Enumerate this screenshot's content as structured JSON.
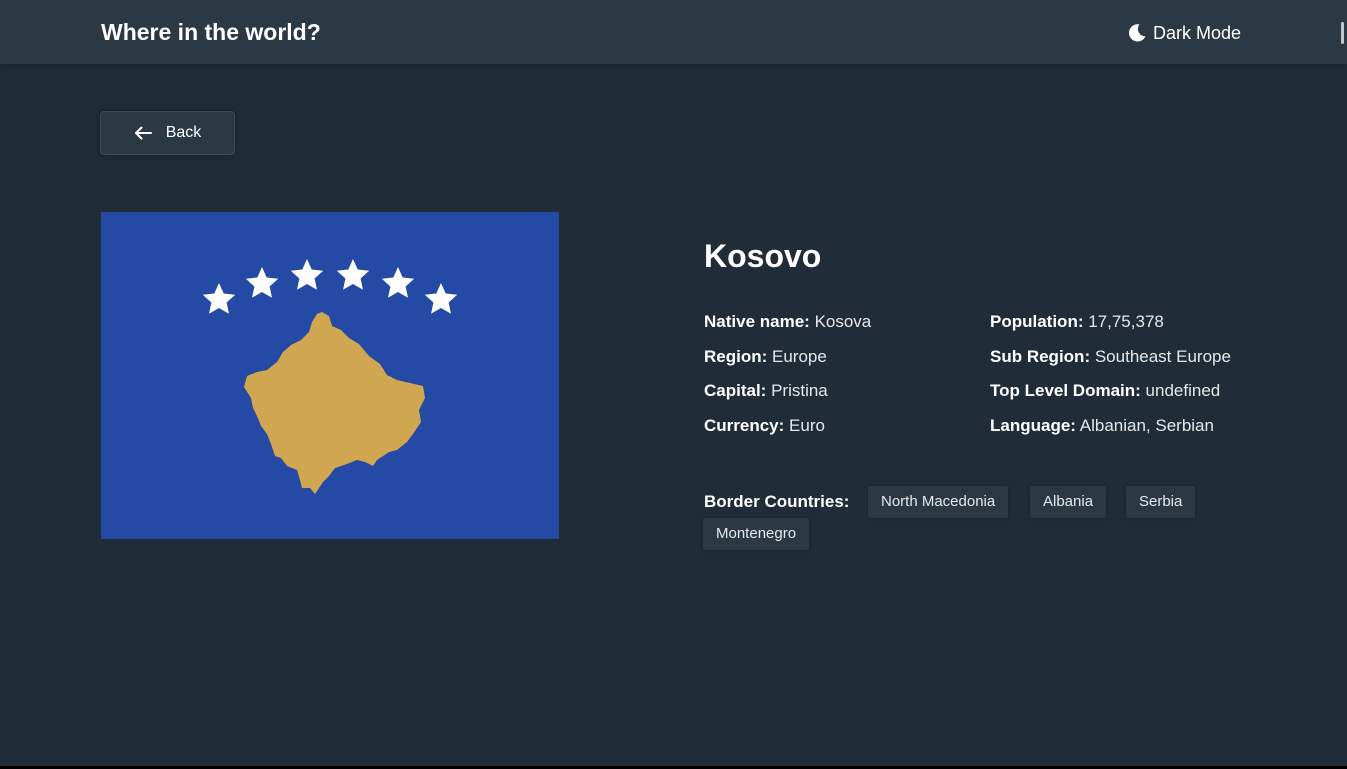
{
  "header": {
    "title": "Where in the world?",
    "dark_mode_label": "Dark Mode",
    "moon_icon": "moon-icon"
  },
  "back_button": {
    "label": "Back",
    "icon": "arrow-left-icon"
  },
  "country": {
    "name": "Kosovo",
    "flag": {
      "icon": "kosovo-flag",
      "field_color": "#244aa5",
      "map_color": "#d0a650",
      "star_color": "#ffffff"
    },
    "details_left": [
      {
        "key": "Native name:",
        "value": "Kosova"
      },
      {
        "key": "Region:",
        "value": "Europe"
      },
      {
        "key": "Capital:",
        "value": "Pristina"
      },
      {
        "key": "Currency:",
        "value": "Euro"
      }
    ],
    "details_right": [
      {
        "key": "Population:",
        "value": "17,75,378"
      },
      {
        "key": "Sub Region:",
        "value": "Southeast Europe"
      },
      {
        "key": "Top Level Domain:",
        "value": "undefined"
      },
      {
        "key": "Language:",
        "value": "Albanian, Serbian"
      }
    ],
    "borders_label": "Border Countries:",
    "border_countries": [
      "North Macedonia",
      "Albania",
      "Serbia",
      "Montenegro"
    ]
  },
  "colors": {
    "background": "#202c37",
    "elements": "#2b3945",
    "text": "#ffffff"
  }
}
